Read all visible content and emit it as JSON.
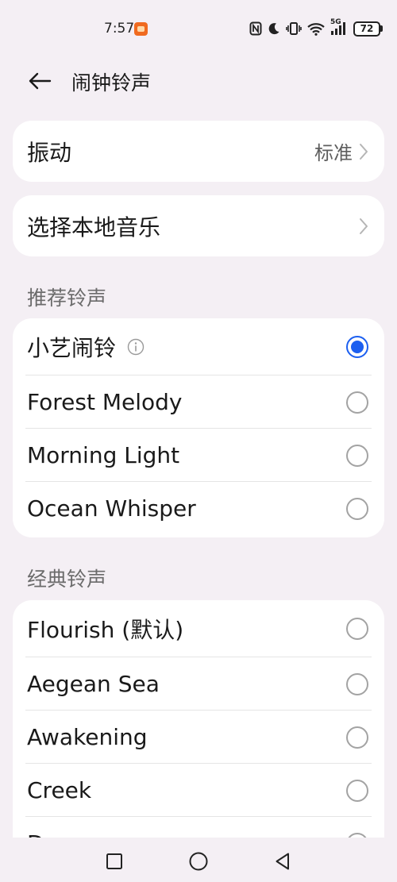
{
  "status_bar": {
    "time": "7:57",
    "network": "5G",
    "battery": "72"
  },
  "header": {
    "title": "闹钟铃声"
  },
  "vibration": {
    "label": "振动",
    "value": "标准"
  },
  "local_music": {
    "label": "选择本地音乐"
  },
  "recommended": {
    "title": "推荐铃声",
    "items": [
      {
        "label": "小艺闹铃",
        "selected": true,
        "has_info": true
      },
      {
        "label": "Forest Melody",
        "selected": false
      },
      {
        "label": "Morning Light",
        "selected": false
      },
      {
        "label": "Ocean Whisper",
        "selected": false
      }
    ]
  },
  "classic": {
    "title": "经典铃声",
    "items": [
      {
        "label": "Flourish (默认)",
        "selected": false
      },
      {
        "label": "Aegean Sea",
        "selected": false
      },
      {
        "label": "Awakening",
        "selected": false
      },
      {
        "label": "Creek",
        "selected": false
      },
      {
        "label": "D",
        "selected": false
      }
    ]
  },
  "colors": {
    "accent": "#1c5ff0",
    "background": "#f4eff4",
    "card": "#ffffff"
  }
}
